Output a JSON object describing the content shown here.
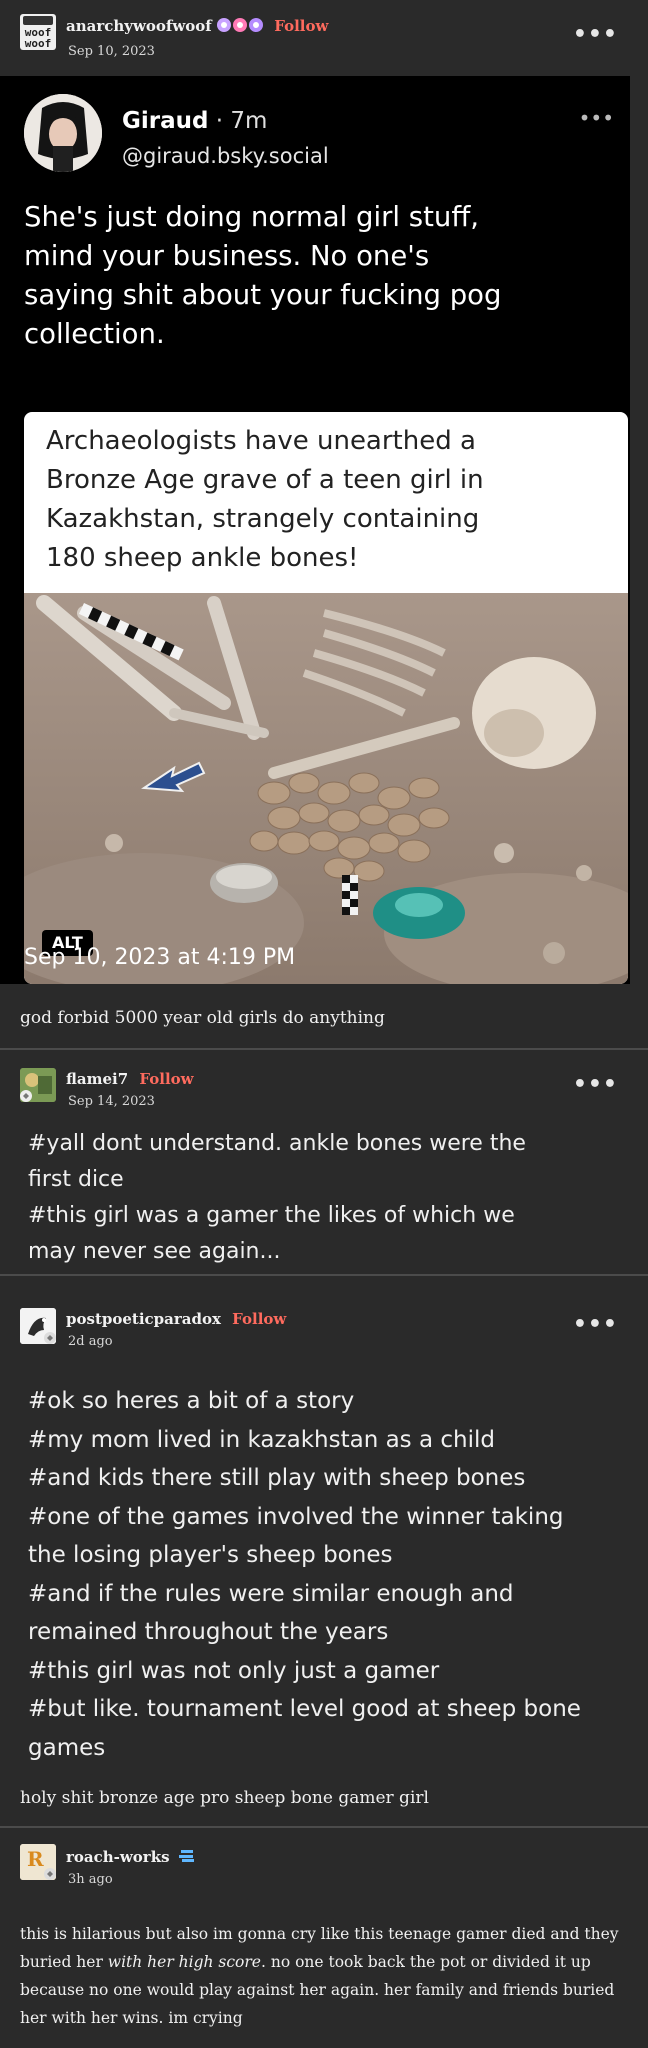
{
  "op": {
    "username": "anarchywoofwoof",
    "follow": "Follow",
    "date": "Sep 10, 2023",
    "avatar_text": [
      "woof",
      "woof"
    ],
    "menu": "•••"
  },
  "tweet": {
    "name": "Giraud",
    "time": "· 7m",
    "handle": "@giraud.bsky.social",
    "menu": "•••",
    "text_lines": [
      "She's just doing normal girl stuff,",
      "mind your business. No one's",
      "saying shit about your fucking pog",
      "collection."
    ],
    "card_lines": [
      "Archaeologists have unearthed a",
      "Bronze Age grave of a teen girl in",
      "Kazakhstan, strangely containing",
      "180 sheep ankle bones!"
    ],
    "alt_badge": "ALT",
    "timestamp": "Sep 10, 2023 at 4:19 PM"
  },
  "op_caption": "god forbid 5000 year old girls do anything",
  "reblog1": {
    "username": "flamei7",
    "follow": "Follow",
    "date": "Sep 14, 2023",
    "menu": "•••",
    "tags": [
      "#yall dont understand. ankle bones were the",
      "first dice",
      "#this girl was a gamer the likes of which we",
      "may never see again..."
    ]
  },
  "reblog2": {
    "username": "postpoeticparadox",
    "follow": "Follow",
    "date": "2d ago",
    "menu": "•••",
    "tags": [
      "#ok so heres a bit of a story",
      "#my mom lived in kazakhstan as a child",
      "#and kids there still play with sheep bones",
      "#one of the games involved the winner taking",
      "the losing player's sheep bones",
      "#and if the rules were similar enough and",
      "remained throughout the years",
      "#this girl was not only just a gamer",
      "#but like. tournament level good at sheep bone",
      "games"
    ],
    "caption": "holy shit bronze age pro sheep bone gamer girl"
  },
  "reblog3": {
    "username": "roach-works",
    "date": "3h ago",
    "avatar_text": "R",
    "body_before": "this is hilarious but also im gonna cry like this teenage gamer died and they buried her ",
    "body_italic": "with her high score",
    "body_after": ". no one took back the pot or divided it up because no one would play against her again. her family and friends buried her with her wins. im crying"
  },
  "colors": {
    "background": "#2a2a2a",
    "follow": "#ff6b5e",
    "tweet_bg": "#000000",
    "divider": "#4b4b4b"
  },
  "icons": [
    "more-icon",
    "badge-icons",
    "reblog-icon",
    "rank-icon",
    "alt-badge"
  ]
}
